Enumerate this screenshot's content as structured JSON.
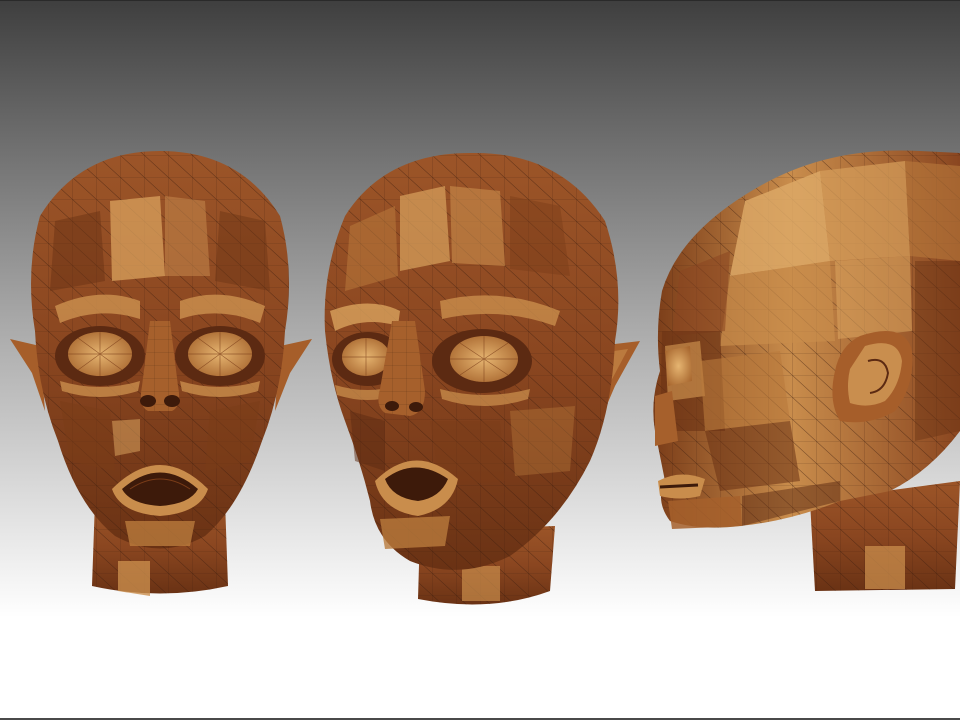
{
  "scene": {
    "views": [
      {
        "view": "front",
        "icon": "head-front-icon"
      },
      {
        "view": "three-quarter",
        "icon": "head-three-quarter-icon"
      },
      {
        "view": "side",
        "icon": "head-side-icon"
      }
    ],
    "colors": {
      "background_top": "#3f3f3f",
      "background_bottom": "#ffffff",
      "skin_light": "#d9a25e",
      "skin_mid": "#a6602c",
      "skin_dark": "#5c2a12",
      "wire": "#3a1c0c"
    }
  }
}
